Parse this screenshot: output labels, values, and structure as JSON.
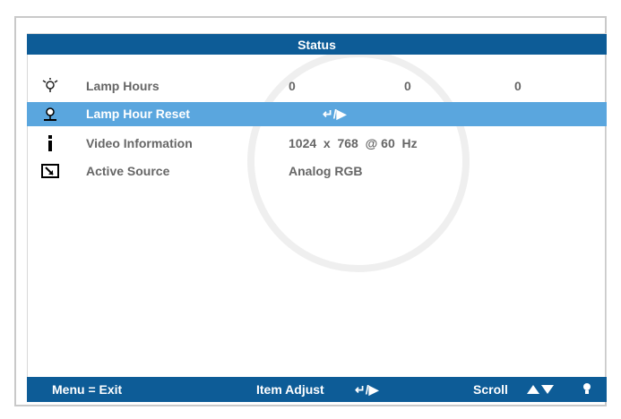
{
  "title": "Status",
  "rows": [
    {
      "icon": "lamp-icon",
      "label": "Lamp Hours",
      "values": [
        "0",
        "0",
        "0"
      ]
    },
    {
      "icon": "lamp-reset-icon",
      "label": "Lamp Hour Reset",
      "values": [
        "↵/▶"
      ]
    },
    {
      "icon": "info-icon",
      "label": "Video Information",
      "values": [
        "1024  x  768  @ 60  Hz"
      ]
    },
    {
      "icon": "source-icon",
      "label": "Active Source",
      "values": [
        "Analog RGB"
      ]
    }
  ],
  "footer": {
    "menu": "Menu = Exit",
    "item_adjust": "Item Adjust",
    "item_adjust_keys": "↵/▶",
    "scroll": "Scroll"
  },
  "colors": {
    "bar": "#0d5c97",
    "selected": "#5aa6de",
    "text": "#666666"
  }
}
